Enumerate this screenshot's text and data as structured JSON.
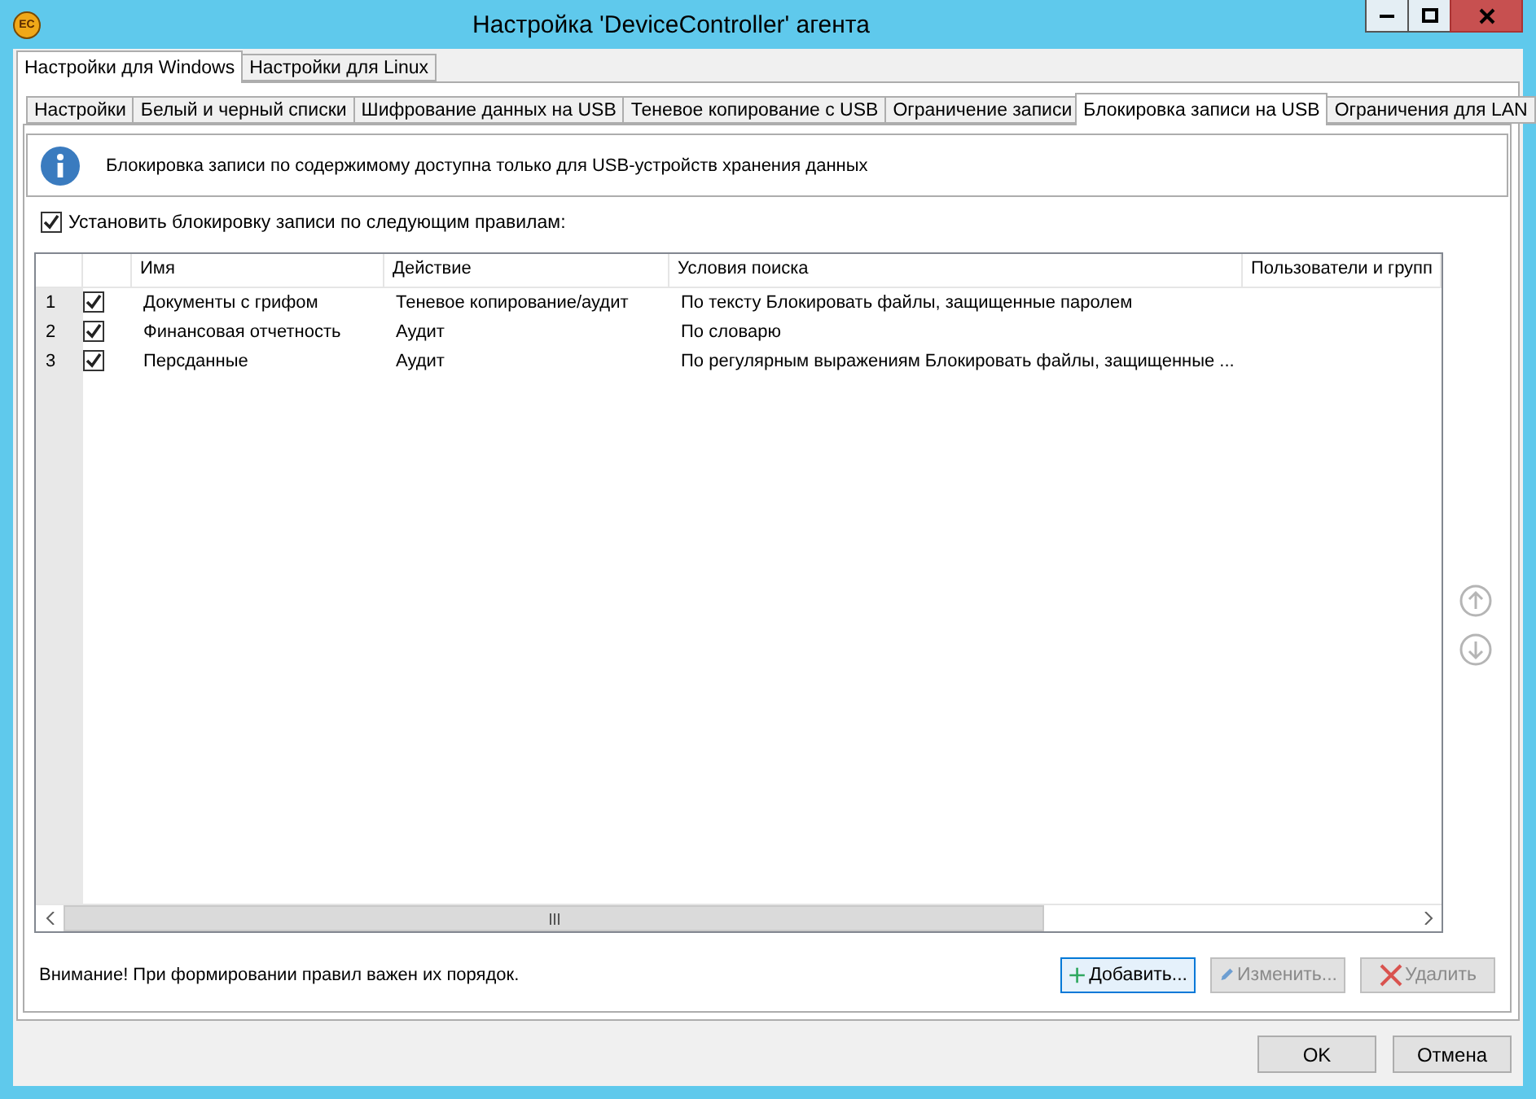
{
  "window": {
    "logo_text": "EC",
    "title": "Настройка 'DeviceController' агента"
  },
  "os_tabs": [
    {
      "label": "Настройки для Windows",
      "selected": true
    },
    {
      "label": "Настройки для Linux",
      "selected": false
    }
  ],
  "tabs": [
    {
      "label": "Настройки",
      "selected": false
    },
    {
      "label": "Белый и черный списки",
      "selected": false
    },
    {
      "label": "Шифрование данных на USB",
      "selected": false
    },
    {
      "label": "Теневое копирование с USB",
      "selected": false
    },
    {
      "label": "Ограничение записи",
      "selected": false
    },
    {
      "label": "Блокировка записи на USB",
      "selected": true
    },
    {
      "label": "Ограничения для LAN",
      "selected": false
    }
  ],
  "info": "Блокировка записи по содержимому доступна только для USB-устройств хранения данных",
  "enable_rules": {
    "label": "Установить блокировку записи по следующим правилам:",
    "checked": true
  },
  "table": {
    "columns": [
      "Имя",
      "Действие",
      "Условия поиска",
      "Пользователи и групп"
    ],
    "rows": [
      {
        "number": "1",
        "checked": true,
        "name": "Документы с грифом",
        "action": "Теневое копирование/аудит",
        "conditions": "По тексту Блокировать файлы, защищенные паролем"
      },
      {
        "number": "2",
        "checked": true,
        "name": "Финансовая отчетность",
        "action": "Аудит",
        "conditions": "По словарю"
      },
      {
        "number": "3",
        "checked": true,
        "name": "Перcданные",
        "action": "Аудит",
        "conditions": "По регулярным выражениям Блокировать файлы, защищенные ..."
      }
    ]
  },
  "note": "Внимание! При формировании правил важен их порядок.",
  "rule_buttons": [
    {
      "kind": "add",
      "label": "Добавить...",
      "disabled": false
    },
    {
      "kind": "edit",
      "label": "Изменить...",
      "disabled": true
    },
    {
      "kind": "delete",
      "label": "Удалить",
      "disabled": true
    }
  ],
  "dialog_buttons": [
    "OK",
    "Отмена"
  ]
}
